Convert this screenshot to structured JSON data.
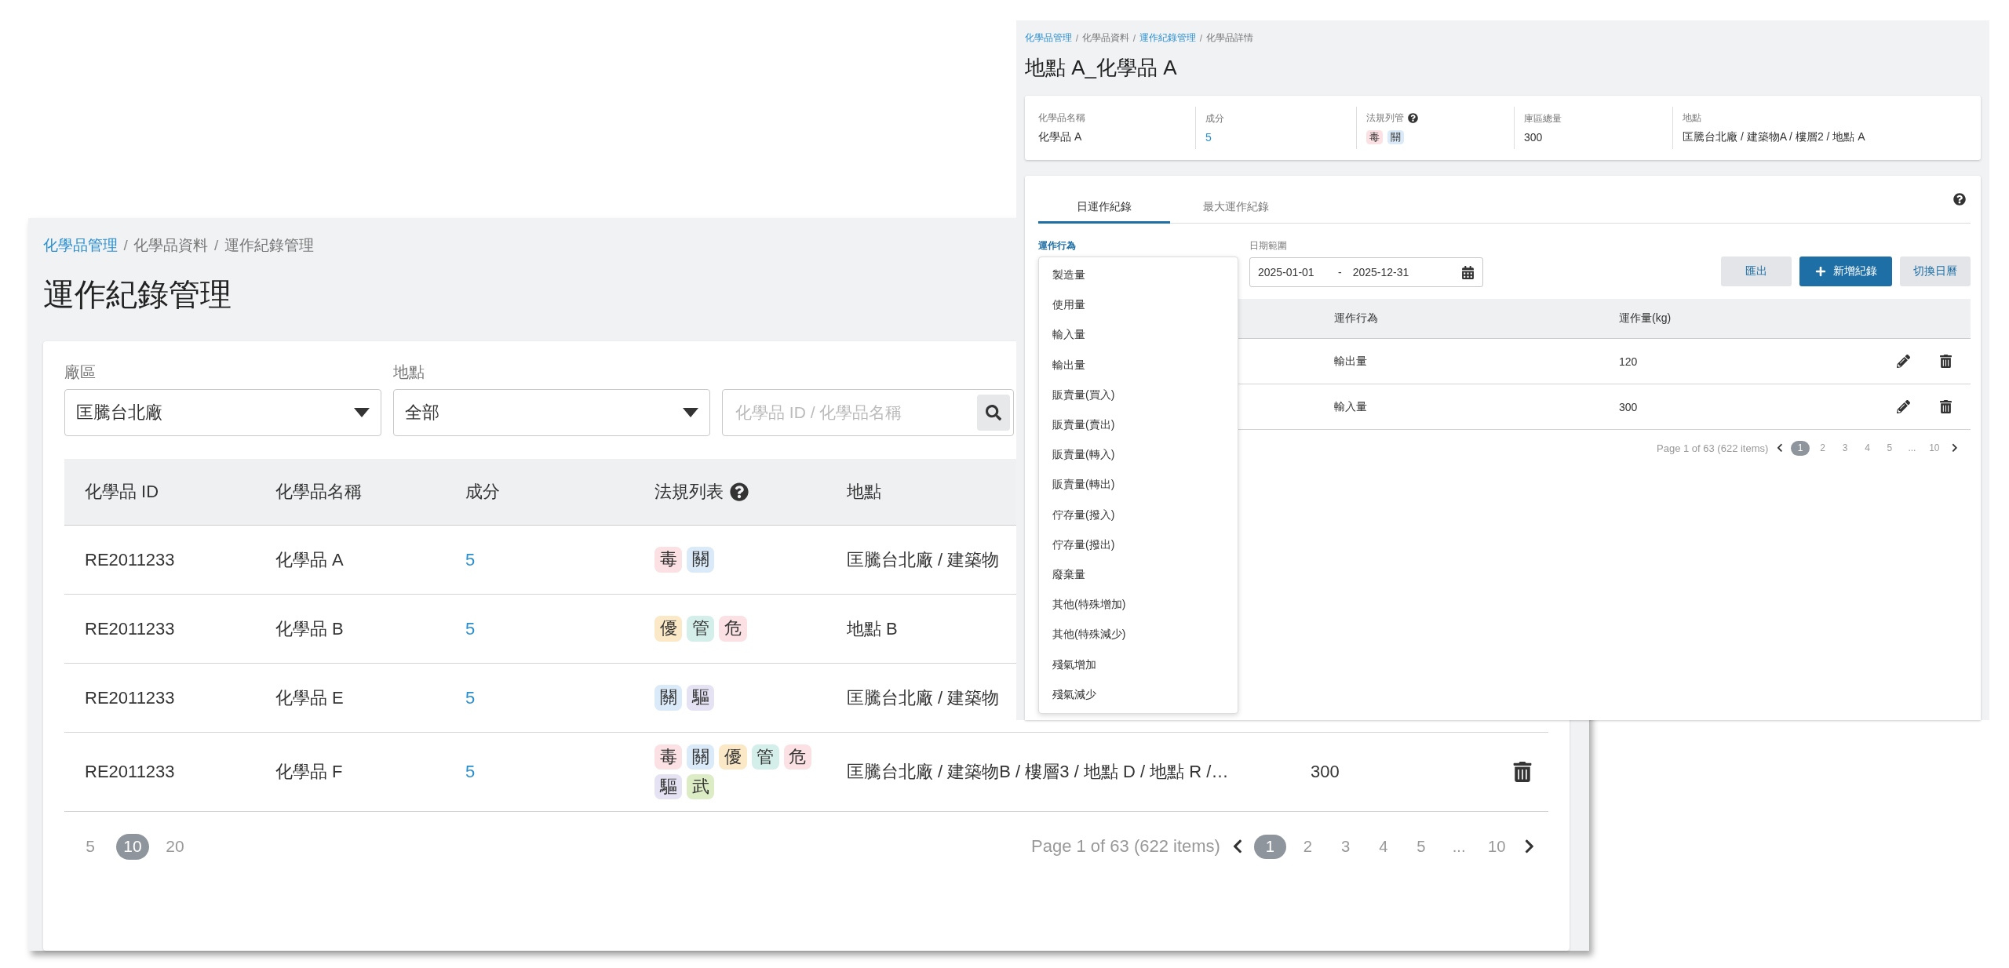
{
  "list_window": {
    "breadcrumb": {
      "separator": "/",
      "items": [
        {
          "text": "化學品管理",
          "link": true
        },
        {
          "text": "化學品資料",
          "link": false
        },
        {
          "text": "運作紀錄管理",
          "link": false
        }
      ]
    },
    "title": "運作紀錄管理",
    "filters": [
      {
        "label": "廠區",
        "value": "匡騰台北廠"
      },
      {
        "label": "地點",
        "value": "全部"
      }
    ],
    "search": {
      "placeholder": "化學品 ID / 化學品名稱"
    },
    "table": {
      "columns": [
        {
          "label": "化學品 ID",
          "help": false
        },
        {
          "label": "化學品名稱",
          "help": false
        },
        {
          "label": "成分",
          "help": false
        },
        {
          "label": "法規列表",
          "help": true
        },
        {
          "label": "地點",
          "help": false
        }
      ],
      "rows": [
        {
          "id": "RE2011233",
          "name": "化學品 A",
          "component": "5",
          "tags": [
            {
              "text": "毒",
              "color": "#fbe1e4"
            },
            {
              "text": "關",
              "color": "#dbeaf8"
            }
          ],
          "location": "匡騰台北廠 / 建築物"
        },
        {
          "id": "RE2011233",
          "name": "化學品 B",
          "component": "5",
          "tags": [
            {
              "text": "優",
              "color": "#fbe8c6"
            },
            {
              "text": "管",
              "color": "#d4efe9"
            },
            {
              "text": "危",
              "color": "#fbe1e4"
            }
          ],
          "location": "地點 B"
        },
        {
          "id": "RE2011233",
          "name": "化學品 E",
          "component": "5",
          "tags": [
            {
              "text": "關",
              "color": "#dbeaf8"
            },
            {
              "text": "驅",
              "color": "#e5e3f3"
            }
          ],
          "location": "匡騰台北廠 / 建築物"
        },
        {
          "id": "RE2011233",
          "name": "化學品 F",
          "component": "5",
          "tags": [
            {
              "text": "毒",
              "color": "#fbe1e4"
            },
            {
              "text": "關",
              "color": "#dbeaf8"
            },
            {
              "text": "優",
              "color": "#fbe8c6"
            },
            {
              "text": "管",
              "color": "#d4efe9"
            },
            {
              "text": "危",
              "color": "#fbe1e4"
            },
            {
              "text": "驅",
              "color": "#e5e3f3"
            },
            {
              "text": "武",
              "color": "#dcedc6"
            }
          ],
          "location": "匡騰台北廠 / 建築物B / 樓層3 / 地點 D / 地點 R /…",
          "total": "300",
          "actions": [
            {
              "kind": "delete"
            }
          ]
        }
      ]
    },
    "page_sizes": [
      {
        "label": "5",
        "selected": false
      },
      {
        "label": "10",
        "selected": true
      },
      {
        "label": "20",
        "selected": false
      }
    ],
    "pagination": {
      "summary": "Page 1 of 63 (622 items)",
      "pages": [
        {
          "label": "1",
          "selected": true
        },
        {
          "label": "2",
          "selected": false
        },
        {
          "label": "3",
          "selected": false
        },
        {
          "label": "4",
          "selected": false
        },
        {
          "label": "5",
          "selected": false
        },
        {
          "label": "...",
          "selected": false
        },
        {
          "label": "10",
          "selected": false
        }
      ]
    }
  },
  "detail_window": {
    "breadcrumb": {
      "separator": "/",
      "items": [
        {
          "text": "化學品管理",
          "link": true
        },
        {
          "text": "化學品資料",
          "link": false
        },
        {
          "text": "運作紀錄管理",
          "link": true
        },
        {
          "text": "化學品詳情",
          "link": false
        }
      ]
    },
    "title": "地點 A_化學品 A",
    "info": [
      {
        "label": "化學品名稱",
        "kind": "text",
        "value": "化學品 A"
      },
      {
        "label": "成分",
        "kind": "link",
        "value": "5"
      },
      {
        "label": "法規列管",
        "kind": "tags",
        "help": true,
        "tags": [
          {
            "text": "毒",
            "color": "#fbe1e4"
          },
          {
            "text": "關",
            "color": "#dbeaf8"
          }
        ]
      },
      {
        "label": "庫區總量",
        "kind": "text",
        "value": "300"
      },
      {
        "label": "地點",
        "kind": "text",
        "value": "匡騰台北廠 / 建築物A / 樓層2 / 地點 A"
      }
    ],
    "tabs": [
      {
        "label": "日運作紀錄",
        "selected": true
      },
      {
        "label": "最大運作紀錄",
        "selected": false
      }
    ],
    "action_filter": {
      "label": "運作行為",
      "open": true,
      "options": [
        "製造量",
        "使用量",
        "輸入量",
        "輸出量",
        "販賣量(買入)",
        "販賣量(賣出)",
        "販賣量(轉入)",
        "販賣量(轉出)",
        "佇存量(撥入)",
        "佇存量(撥出)",
        "廢棄量",
        "其他(特殊增加)",
        "其他(特殊減少)",
        "殘氣增加",
        "殘氣減少"
      ]
    },
    "date_range": {
      "label": "日期範圍",
      "start": "2025-01-01",
      "separator": "-",
      "end": "2025-12-31"
    },
    "buttons": [
      {
        "label": "匯出",
        "kind": "secondary"
      },
      {
        "label": "新增紀錄",
        "kind": "primary"
      },
      {
        "label": "切換日曆",
        "kind": "secondary"
      }
    ],
    "table": {
      "columns": [
        "運作行為",
        "運作量(kg)"
      ],
      "rows": [
        {
          "action": "輸出量",
          "amount": "120"
        },
        {
          "action": "輸入量",
          "amount": "300"
        }
      ]
    },
    "pagination": {
      "summary": "Page 1 of 63 (622 items)",
      "pages": [
        {
          "label": "1",
          "selected": true
        },
        {
          "label": "2",
          "selected": false
        },
        {
          "label": "3",
          "selected": false
        },
        {
          "label": "4",
          "selected": false
        },
        {
          "label": "5",
          "selected": false
        },
        {
          "label": "...",
          "selected": false
        },
        {
          "label": "10",
          "selected": false
        }
      ]
    }
  }
}
